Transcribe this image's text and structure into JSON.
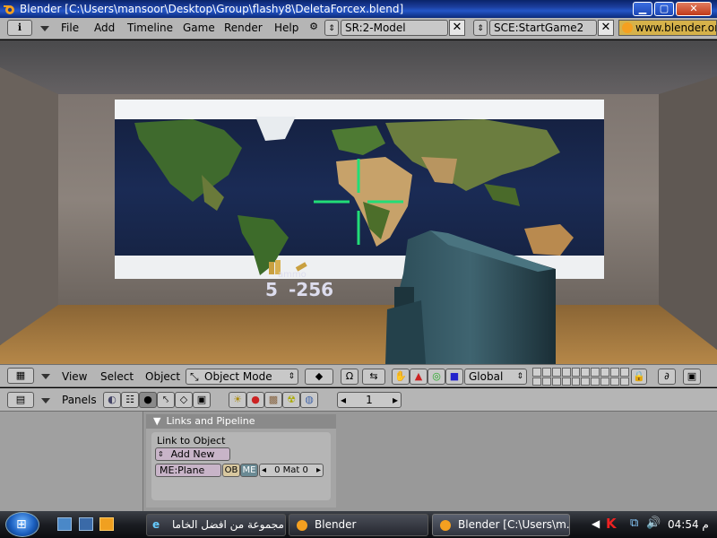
{
  "window": {
    "title": "Blender [C:\\Users\\mansoor\\Desktop\\Group\\flashy8\\DeletaForcex.blend]",
    "controls": [
      "minimize",
      "maximize",
      "close"
    ]
  },
  "top_header": {
    "menus": [
      "File",
      "Add",
      "Timeline",
      "Game",
      "Render",
      "Help"
    ],
    "screen_field": "SR:2-Model",
    "scene_field": "SCE:StartGame2",
    "url": "www.blender.or"
  },
  "viewport": {
    "hud_ammo": "5",
    "hud_score": "-256",
    "ammo_label": "ammo"
  },
  "view3d_header": {
    "menus": [
      "View",
      "Select",
      "Object"
    ],
    "mode": "Object Mode",
    "orientation": "Global"
  },
  "buttons_header": {
    "panels_label": "Panels",
    "frame": "1"
  },
  "links_panel": {
    "title": "Links and Pipeline",
    "link_to_object": "Link to Object",
    "add_new": "Add New",
    "mesh_name": "ME:Plane",
    "ob_tag": "OB",
    "me_tag": "ME",
    "mat_field": "0 Mat 0"
  },
  "taskbar": {
    "tasks": [
      "مجموعة من افضل الخاما...",
      "Blender",
      "Blender [C:\\Users\\m..."
    ],
    "time": "04:54 م"
  },
  "colors": {
    "title_blue": "#1c3f9e",
    "blender_header": "#b5b5b5",
    "crosshair": "#22dd77",
    "floor": "#a5783c"
  }
}
